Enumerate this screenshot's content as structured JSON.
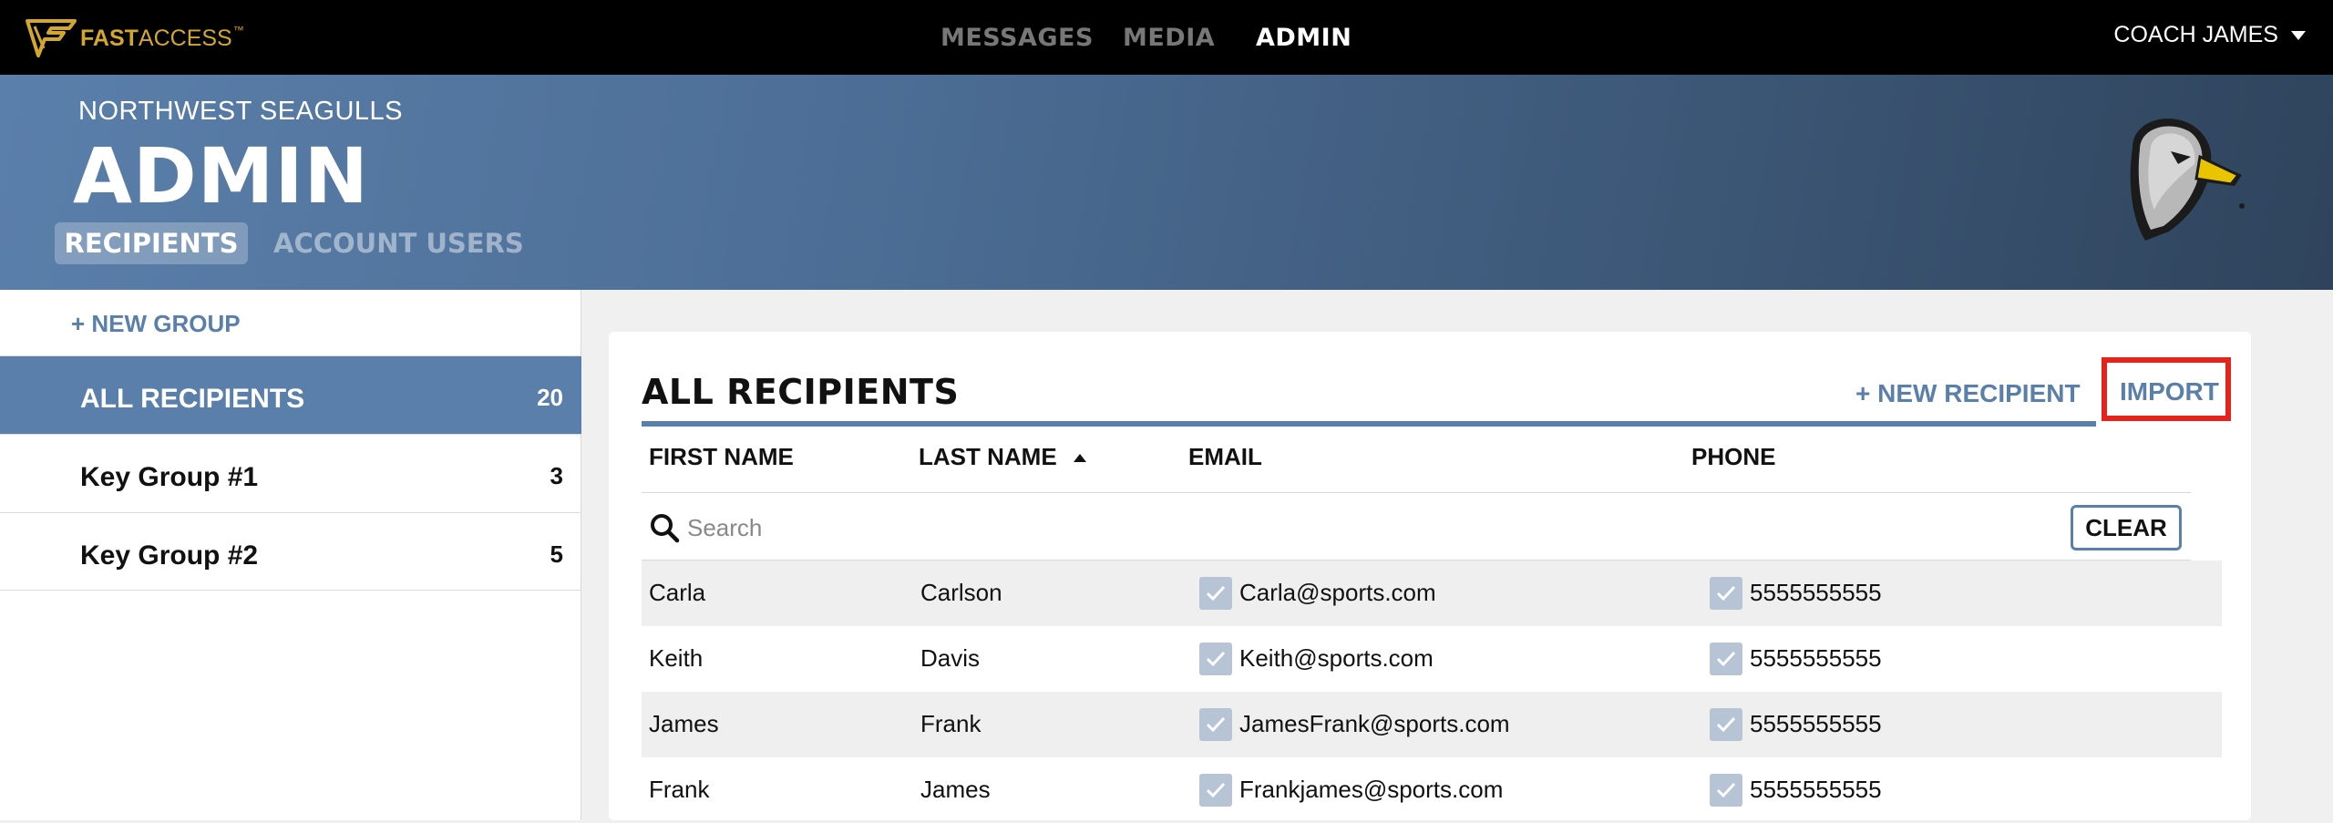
{
  "brand": {
    "bold": "FAST",
    "light": "ACCESS",
    "tm": "™"
  },
  "nav": {
    "items": [
      {
        "label": "MESSAGES",
        "active": false
      },
      {
        "label": "MEDIA",
        "active": false
      },
      {
        "label": "ADMIN",
        "active": true
      }
    ]
  },
  "user": {
    "name": "COACH JAMES"
  },
  "header": {
    "team": "NORTHWEST SEAGULLS",
    "title": "ADMIN",
    "tabs": [
      {
        "label": "RECIPIENTS",
        "active": true
      },
      {
        "label": "ACCOUNT USERS",
        "active": false
      }
    ]
  },
  "sidebar": {
    "new_group": "+ NEW GROUP",
    "groups": [
      {
        "label": "ALL RECIPIENTS",
        "count": "20",
        "active": true
      },
      {
        "label": "Key Group #1",
        "count": "3",
        "active": false
      },
      {
        "label": "Key Group #2",
        "count": "5",
        "active": false
      }
    ]
  },
  "main": {
    "title": "ALL RECIPIENTS",
    "new_recipient": "+ NEW RECIPIENT",
    "import": "IMPORT",
    "columns": {
      "first": "FIRST NAME",
      "last": "LAST NAME",
      "email": "EMAIL",
      "phone": "PHONE"
    },
    "search": {
      "placeholder": "Search",
      "value": ""
    },
    "clear": "CLEAR",
    "rows": [
      {
        "first": "Carla",
        "last": "Carlson",
        "email": "Carla@sports.com",
        "phone": "5555555555"
      },
      {
        "first": "Keith",
        "last": "Davis",
        "email": "Keith@sports.com",
        "phone": "5555555555"
      },
      {
        "first": "James",
        "last": "Frank",
        "email": "JamesFrank@sports.com",
        "phone": "5555555555"
      },
      {
        "first": "Frank",
        "last": "James",
        "email": "Frankjames@sports.com",
        "phone": "5555555555"
      }
    ]
  },
  "colors": {
    "accent": "#5a7faa",
    "highlight": "#e3231c",
    "brand_gold": "#d3a72b",
    "topbar": "#000000"
  },
  "icons": [
    "fastaccess-logo-icon",
    "caret-down-icon",
    "seagull-mascot-icon",
    "sort-up-icon",
    "search-icon",
    "checkbox-checked-icon"
  ]
}
